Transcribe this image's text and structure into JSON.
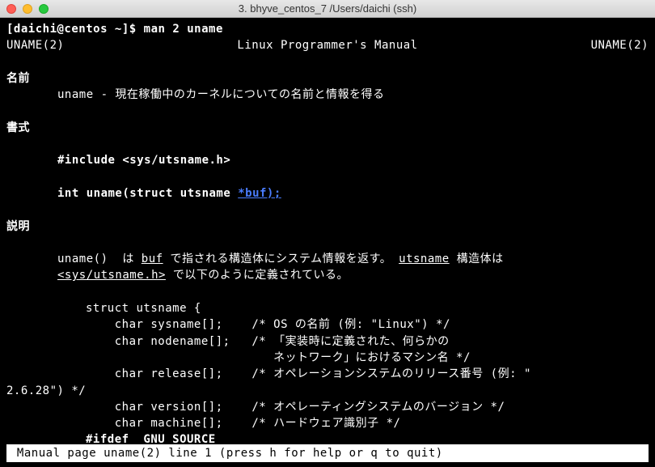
{
  "window": {
    "title": "3. bhyve_centos_7  /Users/daichi (ssh)"
  },
  "prompt": {
    "user_host": "[daichi@centos ~]$ ",
    "command": "man 2 uname"
  },
  "man_header": {
    "left": "UNAME(2)",
    "center": "Linux Programmer's Manual",
    "right": "UNAME(2)"
  },
  "sections": {
    "name": {
      "title": "名前",
      "content": "uname - 現在稼働中のカーネルについての名前と情報を得る"
    },
    "synopsis": {
      "title": "書式",
      "include": "#include <sys/utsname.h>",
      "func_pre": "int uname(struct utsname ",
      "func_link": "*buf);"
    },
    "description": {
      "title": "説明",
      "para1_pre": "uname()  は ",
      "para1_buf": "buf",
      "para1_mid": " で指される構造体にシステム情報を返す。 ",
      "para1_uts": "utsname",
      "para1_post": " 構造体は",
      "para2_header": "<sys/utsname.h>",
      "para2_post": " で以下のように定義されている。",
      "struct_open": "struct utsname {",
      "field_sysname": "    char sysname[];    /* OS の名前 (例: \"Linux\") */",
      "field_nodename": "    char nodename[];   /* 「実装時に定義された、何らかの",
      "field_nodename2": "                          ネットワーク」におけるマシン名 */",
      "field_release": "    char release[];    /* オペレーションシステムのリリース番号 (例: \"",
      "field_release2": "2.6.28\") */",
      "field_version": "    char version[];    /* オペレーティングシステムのバージョン */",
      "field_machine": "    char machine[];    /* ハードウェア識別子 */",
      "ifdef": "#ifdef _GNU_SOURCE"
    }
  },
  "statusbar": " Manual page uname(2) line 1 (press h for help or q to quit)"
}
